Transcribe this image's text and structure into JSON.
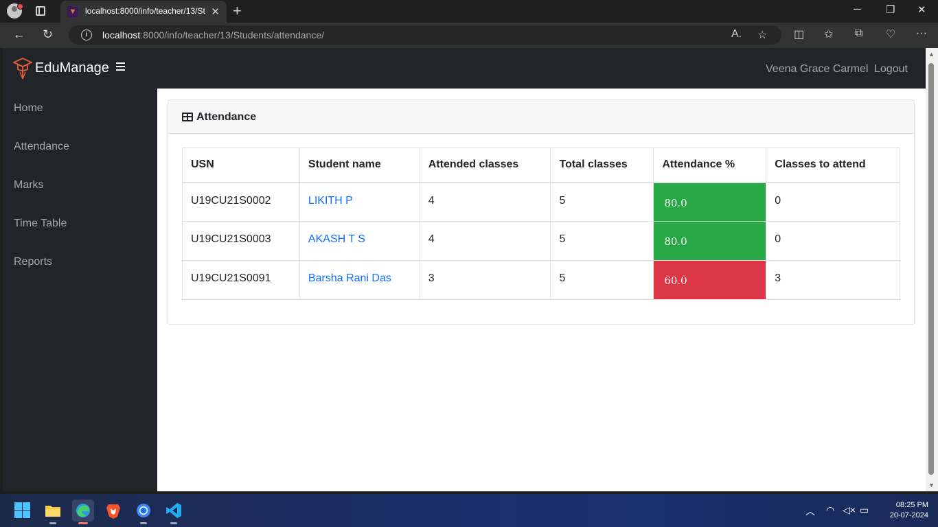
{
  "browser": {
    "tab_title": "localhost:8000/info/teacher/13/Students/attendance/",
    "url_host": "localhost",
    "url_path": ":8000/info/teacher/13/Students/attendance/"
  },
  "app": {
    "brand": "EduManage",
    "user_name": "Veena Grace Carmel",
    "logout_label": "Logout"
  },
  "sidebar": {
    "items": [
      {
        "label": "Home"
      },
      {
        "label": "Attendance"
      },
      {
        "label": "Marks"
      },
      {
        "label": "Time Table"
      },
      {
        "label": "Reports"
      }
    ]
  },
  "card": {
    "title": "Attendance"
  },
  "table": {
    "headers": [
      "USN",
      "Student name",
      "Attended classes",
      "Total classes",
      "Attendance %",
      "Classes to attend"
    ],
    "rows": [
      {
        "usn": "U19CU21S0002",
        "name": "LIKITH P",
        "attended": "4",
        "total": "5",
        "percent": "80.0",
        "status": "good",
        "to_attend": "0"
      },
      {
        "usn": "U19CU21S0003",
        "name": "AKASH T S",
        "attended": "4",
        "total": "5",
        "percent": "80.0",
        "status": "good",
        "to_attend": "0"
      },
      {
        "usn": "U19CU21S0091",
        "name": "Barsha Rani Das",
        "attended": "3",
        "total": "5",
        "percent": "60.0",
        "status": "bad",
        "to_attend": "3"
      }
    ]
  },
  "colors": {
    "good": "#28a745",
    "bad": "#dc3545",
    "link": "#0d6efd",
    "nav_bg": "#212529"
  },
  "taskbar": {
    "time": "08:25 PM",
    "date": "20-07-2024"
  }
}
